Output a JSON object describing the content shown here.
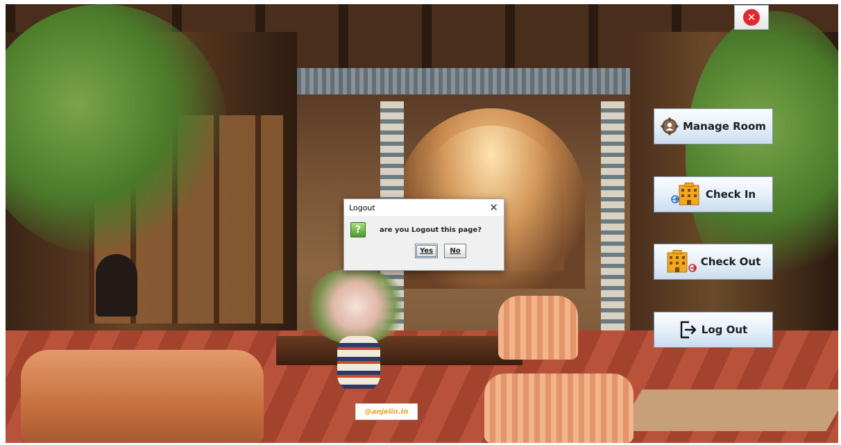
{
  "window": {
    "close_icon_glyph": "✕",
    "colors": {
      "close": "#e0282e",
      "button_border": "#7b93ad"
    }
  },
  "actions": [
    {
      "label": "Manage Room",
      "icon": "gear-icon"
    },
    {
      "label": "Check In",
      "icon": "hotel-check-in-icon"
    },
    {
      "label": "Check Out",
      "icon": "hotel-check-out-icon"
    },
    {
      "label": "Log Out",
      "icon": "logout-icon"
    }
  ],
  "dialog": {
    "title": "Logout",
    "close_glyph": "✕",
    "icon_glyph": "?",
    "message": "are you Logout this page?",
    "yes_label": "Yes",
    "no_label": "No"
  },
  "watermark": {
    "text": "@anjelin.In"
  }
}
